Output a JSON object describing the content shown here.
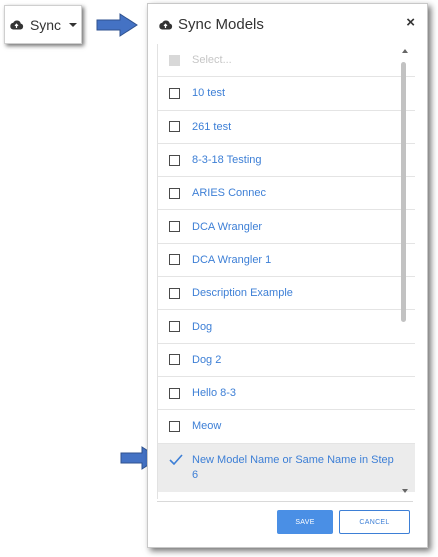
{
  "sync_button": {
    "label": "Sync",
    "icon": "cloud-upload-icon"
  },
  "modal": {
    "title": "Sync Models",
    "title_icon": "cloud-upload-icon",
    "close_label": "×",
    "select_all_label": "Select...",
    "items": [
      {
        "label": "10 test",
        "checked": false
      },
      {
        "label": "261 test",
        "checked": false
      },
      {
        "label": "8-3-18 Testing",
        "checked": false
      },
      {
        "label": "ARIES Connec",
        "checked": false
      },
      {
        "label": "DCA Wrangler",
        "checked": false
      },
      {
        "label": "DCA Wrangler 1",
        "checked": false
      },
      {
        "label": "Description Example",
        "checked": false
      },
      {
        "label": "Dog",
        "checked": false
      },
      {
        "label": "Dog 2",
        "checked": false
      },
      {
        "label": "Hello 8-3",
        "checked": false
      },
      {
        "label": "Meow",
        "checked": false
      },
      {
        "label": "New Model Name or Same Name in Step 6",
        "checked": true
      }
    ],
    "save_label": "SAVE",
    "cancel_label": "CANCEL"
  },
  "colors": {
    "link_blue": "#3d7fd6",
    "primary_button": "#4a8fe5",
    "guide_arrow": "#4472c4",
    "selected_row": "#ececec"
  }
}
